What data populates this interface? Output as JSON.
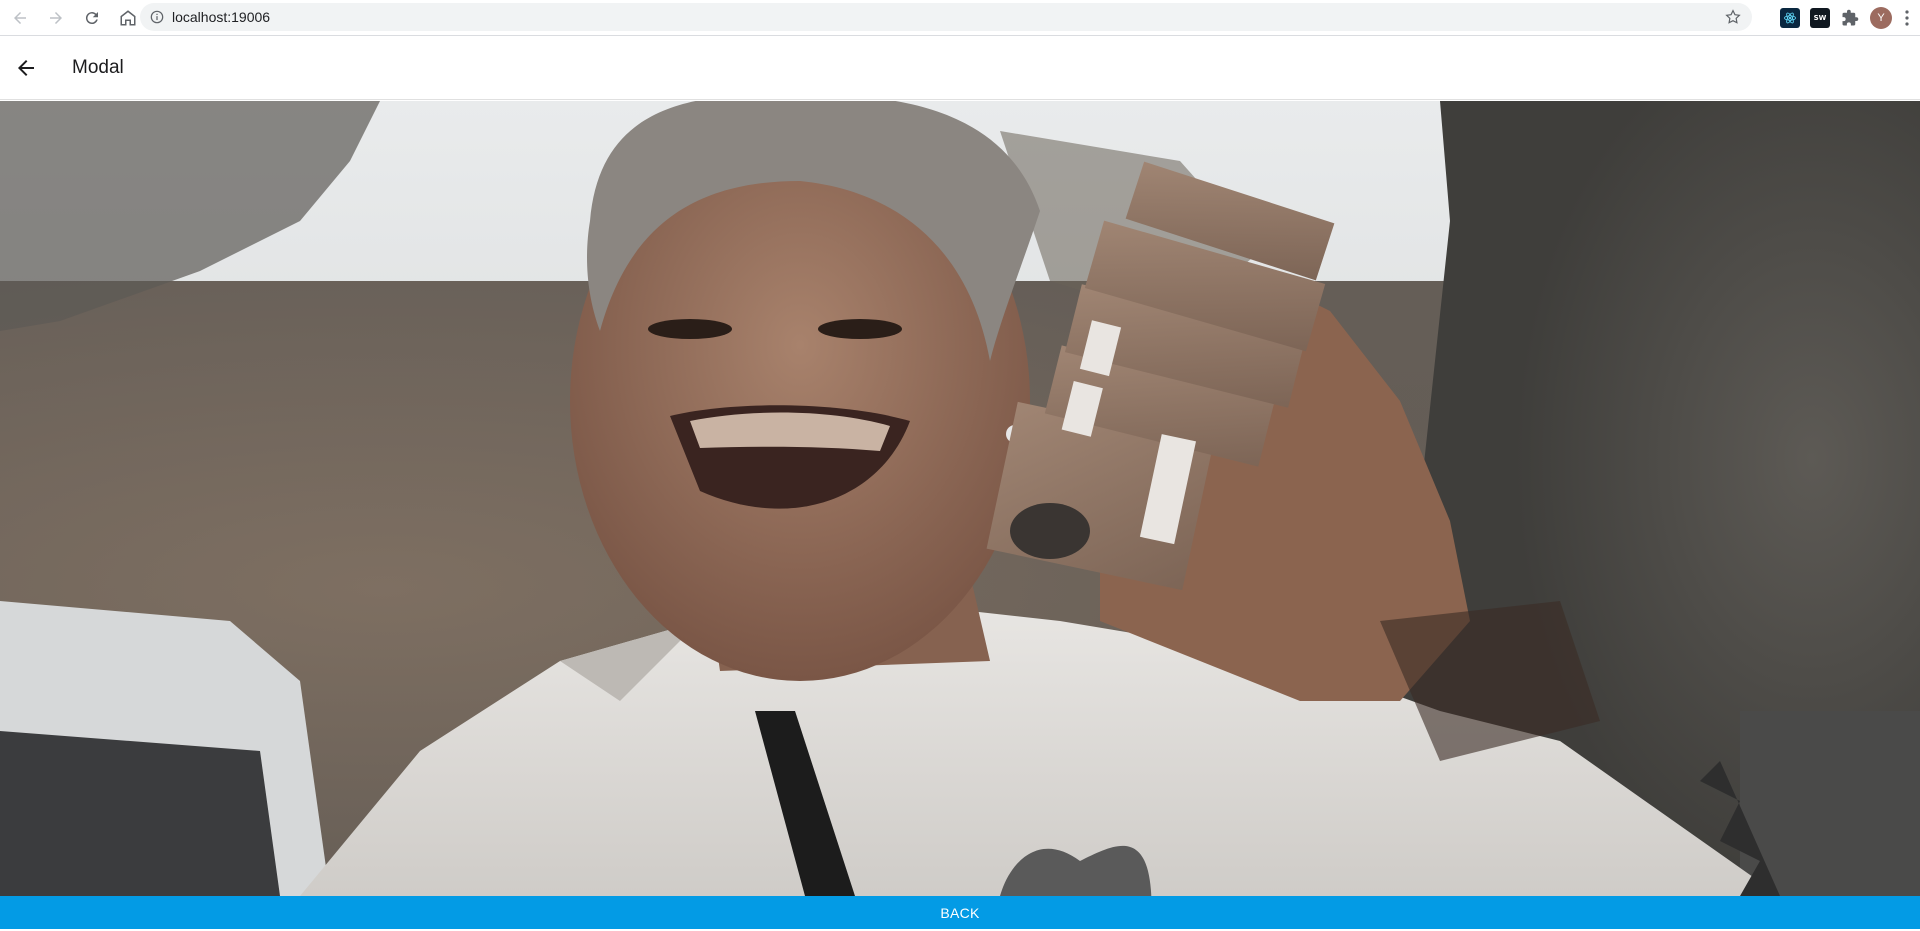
{
  "browser": {
    "url": "localhost:19006",
    "profile_initial": "Y",
    "extensions": [
      "react-devtools-icon",
      "sw-extension-icon",
      "puzzle-icon"
    ],
    "sw_label": "SW"
  },
  "header": {
    "title": "Modal",
    "back_icon": "arrow-left-icon"
  },
  "photo": {
    "subject": "photo"
  },
  "footer": {
    "button_label": "BACK",
    "button_color": "#039be5"
  },
  "colors": {
    "accent": "#039be5"
  }
}
